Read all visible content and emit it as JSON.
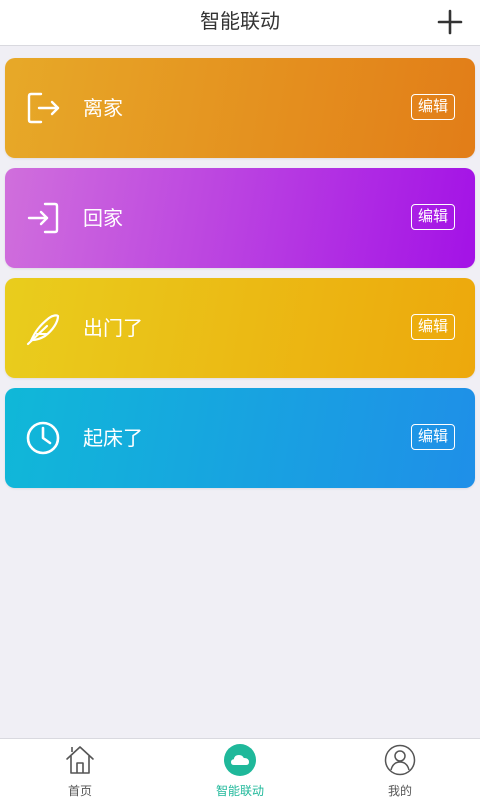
{
  "header": {
    "title": "智能联动",
    "add_icon": "plus-icon"
  },
  "scenes": [
    {
      "label": "离家",
      "icon": "logout-icon",
      "edit_label": "编辑",
      "gradient": [
        "#e7a928",
        "#e27d18"
      ]
    },
    {
      "label": "回家",
      "icon": "login-icon",
      "edit_label": "编辑",
      "gradient": [
        "#d06fdc",
        "#a312e6"
      ]
    },
    {
      "label": "出门了",
      "icon": "feather-icon",
      "edit_label": "编辑",
      "gradient": [
        "#e9cd1d",
        "#eda80c"
      ]
    },
    {
      "label": "起床了",
      "icon": "clock-icon",
      "edit_label": "编辑",
      "gradient": [
        "#10b8d8",
        "#1f8fe8"
      ]
    }
  ],
  "tabbar": {
    "items": [
      {
        "label": "首页",
        "icon": "home-icon",
        "active": false
      },
      {
        "label": "智能联动",
        "icon": "cloud-icon",
        "active": true
      },
      {
        "label": "我的",
        "icon": "user-icon",
        "active": false
      }
    ],
    "active_color": "#1fb89a"
  }
}
